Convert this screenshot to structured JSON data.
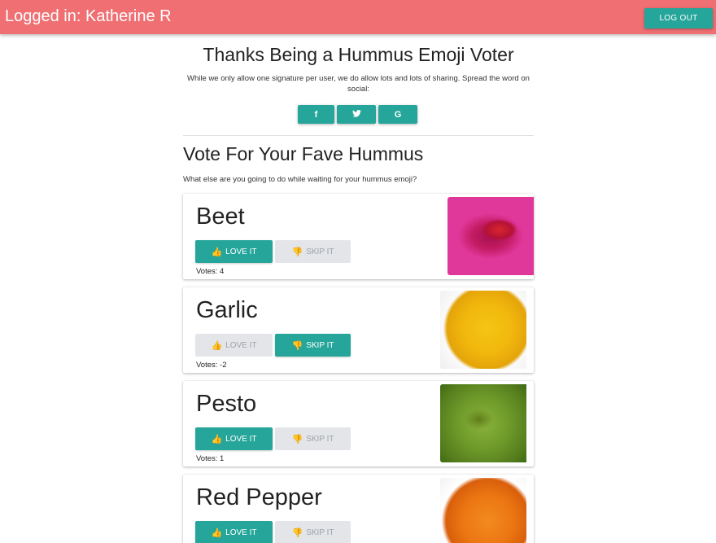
{
  "header": {
    "logged_in_text": "Logged in: Katherine R",
    "logout_label": "LOG OUT",
    "bar_color": "#ef6f73"
  },
  "share": {
    "title": "Thanks Being a Hummus Emoji Voter",
    "text": "While we only allow one signature per user, we do allow lots and lots of sharing. Spread the word on social:",
    "buttons": [
      {
        "icon": "facebook-icon",
        "glyph": "f"
      },
      {
        "icon": "twitter-icon",
        "glyph": "🐦"
      },
      {
        "icon": "google-icon",
        "glyph": "G"
      }
    ]
  },
  "vote": {
    "title": "Vote For Your Fave Hummus",
    "subtitle": "What else are you going to do while waiting for your hummus emoji?",
    "love_label": "LOVE IT",
    "skip_label": "SKIP IT",
    "items": [
      {
        "name": "Beet",
        "votes": "Votes: 4",
        "selected": "love"
      },
      {
        "name": "Garlic",
        "votes": "Votes: -2",
        "selected": "skip"
      },
      {
        "name": "Pesto",
        "votes": "Votes: 1",
        "selected": "love"
      },
      {
        "name": "Red Pepper",
        "votes": "",
        "selected": "love"
      }
    ]
  },
  "colors": {
    "accent": "#26a69a",
    "header": "#ef6f73",
    "inactive_button": "#e3e5e8"
  }
}
